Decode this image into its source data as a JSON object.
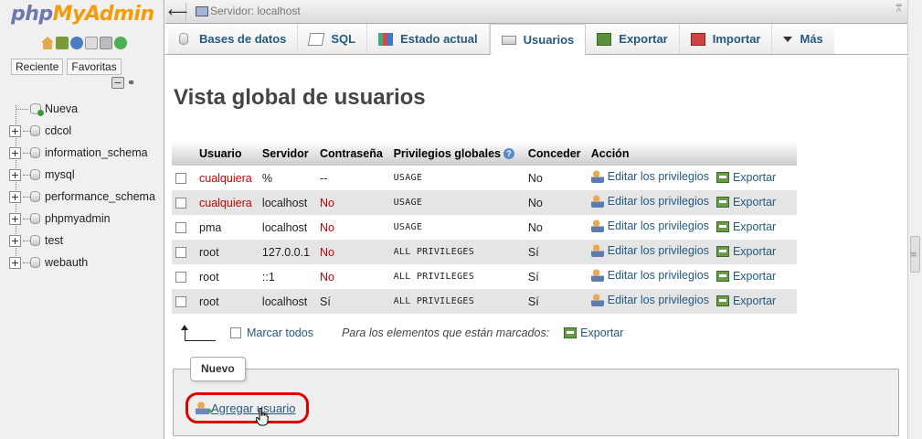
{
  "sidebar": {
    "logo_php": "php",
    "logo_rest": "MyAdmin",
    "tabs": [
      "Reciente",
      "Favoritas"
    ],
    "new_label": "Nueva",
    "databases": [
      "cdcol",
      "information_schema",
      "mysql",
      "performance_schema",
      "phpmyadmin",
      "test",
      "webauth"
    ]
  },
  "topbar": {
    "server_label": "Servidor: localhost"
  },
  "menu": {
    "tabs": [
      {
        "label": "Bases de datos",
        "icon": "database-icon"
      },
      {
        "label": "SQL",
        "icon": "sql-icon"
      },
      {
        "label": "Estado actual",
        "icon": "status-icon"
      },
      {
        "label": "Usuarios",
        "icon": "users-icon",
        "active": true
      },
      {
        "label": "Exportar",
        "icon": "export-icon"
      },
      {
        "label": "Importar",
        "icon": "import-icon"
      },
      {
        "label": "Más",
        "icon": "chevron-down-icon"
      }
    ]
  },
  "page": {
    "title": "Vista global de usuarios"
  },
  "table": {
    "headers": [
      "Usuario",
      "Servidor",
      "Contraseña",
      "Privilegios globales",
      "Conceder",
      "Acción"
    ],
    "action_edit": "Editar los privilegios",
    "action_export": "Exportar",
    "rows": [
      {
        "user": "cualquiera",
        "host": "%",
        "password": "--",
        "privileges": "USAGE",
        "grant": "No",
        "user_red": true,
        "pass_red": false
      },
      {
        "user": "cualquiera",
        "host": "localhost",
        "password": "No",
        "privileges": "USAGE",
        "grant": "No",
        "user_red": true,
        "pass_red": true
      },
      {
        "user": "pma",
        "host": "localhost",
        "password": "No",
        "privileges": "USAGE",
        "grant": "No",
        "user_red": false,
        "pass_red": true
      },
      {
        "user": "root",
        "host": "127.0.0.1",
        "password": "No",
        "privileges": "ALL PRIVILEGES",
        "grant": "Sí",
        "user_red": false,
        "pass_red": true
      },
      {
        "user": "root",
        "host": "::1",
        "password": "No",
        "privileges": "ALL PRIVILEGES",
        "grant": "Sí",
        "user_red": false,
        "pass_red": true
      },
      {
        "user": "root",
        "host": "localhost",
        "password": "Sí",
        "privileges": "ALL PRIVILEGES",
        "grant": "Sí",
        "user_red": false,
        "pass_red": false
      }
    ]
  },
  "bottom": {
    "check_all": "Marcar todos",
    "marked_label": "Para los elementos que están marcados:",
    "export": "Exportar"
  },
  "new_section": {
    "legend": "Nuevo",
    "add_user": "Agregar usuario"
  }
}
